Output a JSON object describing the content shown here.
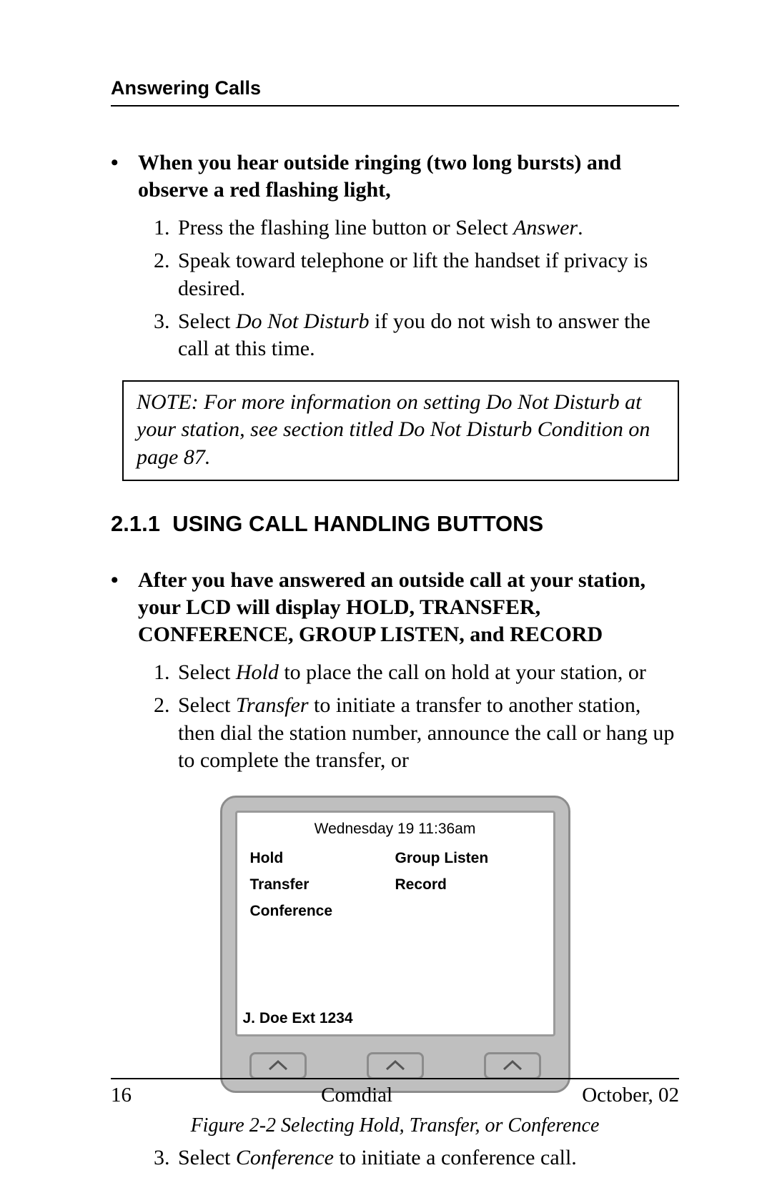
{
  "header": {
    "running": "Answering Calls"
  },
  "section1": {
    "bullet": "When you hear outside ringing (two long bursts) and observe a red flashing light,",
    "steps": {
      "s1a": "Press the  flashing line button or Select ",
      "s1b": "Answer",
      "s1c": ".",
      "s2": "Speak toward telephone or lift the handset if privacy is desired.",
      "s3a": "Select ",
      "s3b": "Do Not Disturb",
      "s3c": " if you do not wish to answer the call at this time."
    },
    "note": "NOTE:  For more information on setting  Do Not Disturb at your station, see section titled Do Not Disturb Condition on page 87."
  },
  "section2": {
    "heading_no": "2.1.1",
    "heading": "USING CALL HANDLING BUTTONS",
    "bullet": "After you have answered an outside call at your station, your LCD will display HOLD, TRANSFER,  CONFERENCE, GROUP LISTEN, and RECORD",
    "steps": {
      "s1a": "Select ",
      "s1b": "Hold",
      "s1c": " to place the call on hold at your station, or",
      "s2a": "Select ",
      "s2b": "Transfer",
      "s2c": " to initiate a transfer to another station, then dial the station number, announce the call or hang up to complete the transfer, or",
      "s3a": "Select ",
      "s3b": "Conference",
      "s3c": " to initiate a conference call."
    }
  },
  "lcd": {
    "timestamp": "Wednesday 19  11:36am",
    "opts": [
      "Hold",
      "Group Listen",
      "Transfer",
      "Record",
      "Conference"
    ],
    "caller": "J. Doe Ext 1234"
  },
  "figcap": "Figure 2-2  Selecting Hold, Transfer, or Conference",
  "footer": {
    "page": "16",
    "center": "Comdial",
    "right": "October, 02"
  }
}
